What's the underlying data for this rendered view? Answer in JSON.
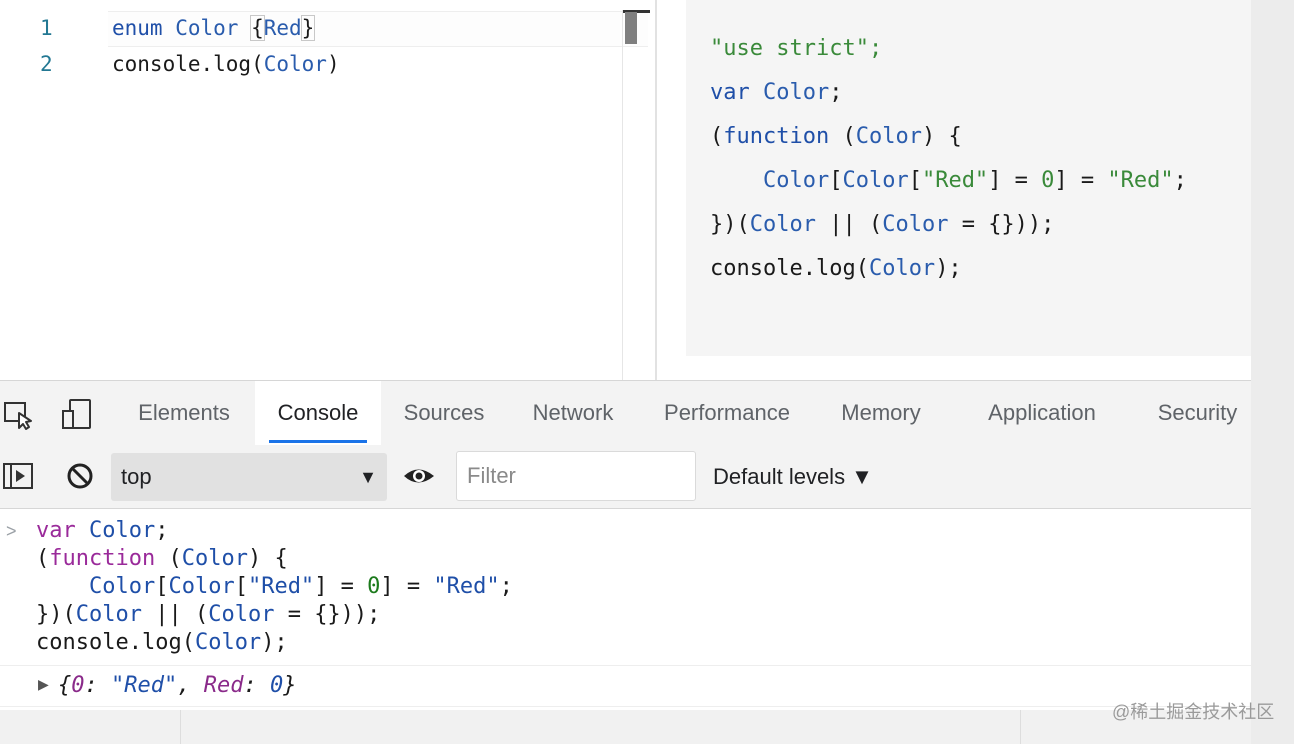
{
  "editor": {
    "lines": [
      {
        "number": "1",
        "tokens": [
          {
            "text": "enum ",
            "kind": "kw"
          },
          {
            "text": "Color ",
            "kind": "id"
          },
          {
            "text": "{",
            "kind": "bracket"
          },
          {
            "text": "Red",
            "kind": "id"
          },
          {
            "text": "}",
            "kind": "bracket"
          }
        ]
      },
      {
        "number": "2",
        "tokens": [
          {
            "text": "console.log(",
            "kind": "plain"
          },
          {
            "text": "Color",
            "kind": "id"
          },
          {
            "text": ")",
            "kind": "plain"
          }
        ]
      }
    ]
  },
  "output": {
    "lines": [
      [
        {
          "text": "\"use strict\";",
          "kind": "str"
        }
      ],
      [
        {
          "text": "var ",
          "kind": "kw"
        },
        {
          "text": "Color",
          "kind": "id"
        },
        {
          "text": ";",
          "kind": "plain"
        }
      ],
      [
        {
          "text": "(",
          "kind": "plain"
        },
        {
          "text": "function",
          "kind": "kw"
        },
        {
          "text": " (",
          "kind": "plain"
        },
        {
          "text": "Color",
          "kind": "id"
        },
        {
          "text": ") {",
          "kind": "plain"
        }
      ],
      [
        {
          "text": "    ",
          "kind": "plain"
        },
        {
          "text": "Color",
          "kind": "id"
        },
        {
          "text": "[",
          "kind": "plain"
        },
        {
          "text": "Color",
          "kind": "id"
        },
        {
          "text": "[",
          "kind": "plain"
        },
        {
          "text": "\"Red\"",
          "kind": "str"
        },
        {
          "text": "] = ",
          "kind": "plain"
        },
        {
          "text": "0",
          "kind": "num"
        },
        {
          "text": "] = ",
          "kind": "plain"
        },
        {
          "text": "\"Red\"",
          "kind": "str"
        },
        {
          "text": ";",
          "kind": "plain"
        }
      ],
      [
        {
          "text": "})(",
          "kind": "plain"
        },
        {
          "text": "Color",
          "kind": "id"
        },
        {
          "text": " || (",
          "kind": "plain"
        },
        {
          "text": "Color",
          "kind": "id"
        },
        {
          "text": " = {}));",
          "kind": "plain"
        }
      ],
      [
        {
          "text": "console.log(",
          "kind": "plain"
        },
        {
          "text": "Color",
          "kind": "id"
        },
        {
          "text": ");",
          "kind": "plain"
        }
      ]
    ]
  },
  "devtools": {
    "tabs": [
      {
        "label": "Elements",
        "active": false
      },
      {
        "label": "Console",
        "active": true
      },
      {
        "label": "Sources",
        "active": false
      },
      {
        "label": "Network",
        "active": false
      },
      {
        "label": "Performance",
        "active": false
      },
      {
        "label": "Memory",
        "active": false
      },
      {
        "label": "Application",
        "active": false
      },
      {
        "label": "Security",
        "active": false
      }
    ],
    "toolbar": {
      "context": "top",
      "filter_placeholder": "Filter",
      "levels": "Default levels ▼"
    }
  },
  "console": {
    "prompt": ">",
    "input_lines": [
      [
        {
          "text": "var ",
          "kind": "kw"
        },
        {
          "text": "Color",
          "kind": "id"
        },
        {
          "text": ";",
          "kind": "plain"
        }
      ],
      [
        {
          "text": "(",
          "kind": "plain"
        },
        {
          "text": "function",
          "kind": "kw"
        },
        {
          "text": " (",
          "kind": "plain"
        },
        {
          "text": "Color",
          "kind": "id"
        },
        {
          "text": ") {",
          "kind": "plain"
        }
      ],
      [
        {
          "text": "    ",
          "kind": "plain"
        },
        {
          "text": "Color",
          "kind": "id"
        },
        {
          "text": "[",
          "kind": "plain"
        },
        {
          "text": "Color",
          "kind": "id"
        },
        {
          "text": "[",
          "kind": "plain"
        },
        {
          "text": "\"Red\"",
          "kind": "str"
        },
        {
          "text": "] = ",
          "kind": "plain"
        },
        {
          "text": "0",
          "kind": "num"
        },
        {
          "text": "] = ",
          "kind": "plain"
        },
        {
          "text": "\"Red\"",
          "kind": "str"
        },
        {
          "text": ";",
          "kind": "plain"
        }
      ],
      [
        {
          "text": "})(",
          "kind": "plain"
        },
        {
          "text": "Color",
          "kind": "id"
        },
        {
          "text": " || (",
          "kind": "plain"
        },
        {
          "text": "Color",
          "kind": "id"
        },
        {
          "text": " = {}));",
          "kind": "plain"
        }
      ],
      [
        {
          "text": "console.log(",
          "kind": "plain"
        },
        {
          "text": "Color",
          "kind": "id"
        },
        {
          "text": ");",
          "kind": "plain"
        }
      ]
    ],
    "output_tokens": [
      {
        "text": "{",
        "kind": "plain"
      },
      {
        "text": "0",
        "kind": "key"
      },
      {
        "text": ": ",
        "kind": "plain"
      },
      {
        "text": "\"Red\"",
        "kind": "str"
      },
      {
        "text": ", ",
        "kind": "plain"
      },
      {
        "text": "Red",
        "kind": "key"
      },
      {
        "text": ": ",
        "kind": "plain"
      },
      {
        "text": "0",
        "kind": "num"
      },
      {
        "text": "}",
        "kind": "plain"
      }
    ]
  },
  "watermark": "@稀土掘金技术社区",
  "icons": [
    "inspect-element-icon",
    "device-toolbar-icon",
    "sidebar-toggle-icon",
    "clear-console-icon",
    "eye-icon"
  ]
}
